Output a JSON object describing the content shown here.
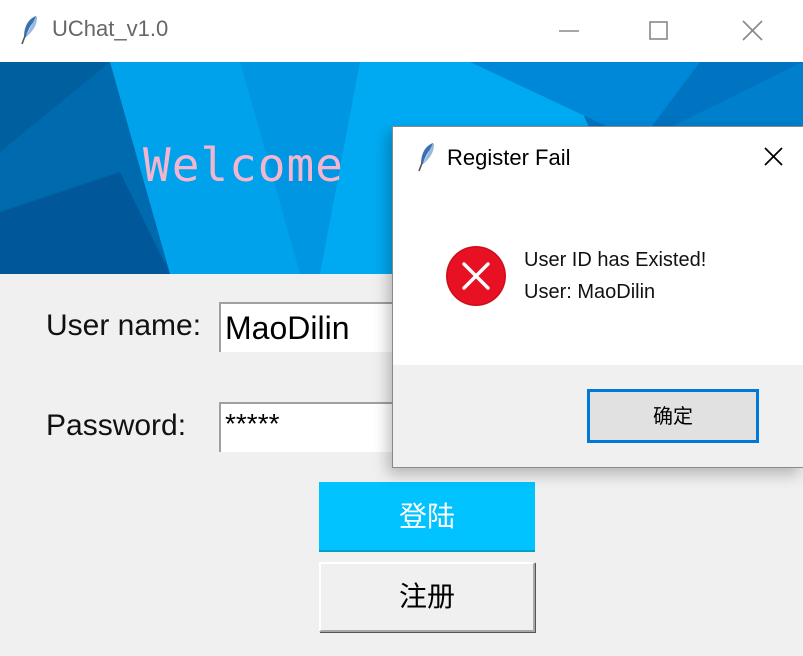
{
  "main_window": {
    "title": "UChat_v1.0",
    "icon": "feather-icon",
    "controls": [
      "minimize-icon",
      "maximize-icon",
      "close-icon"
    ]
  },
  "banner": {
    "text": "Welcome",
    "colors": [
      "#0060a0",
      "#0078c8",
      "#00a8f0",
      "#0090e0"
    ],
    "text_color": "#f4b6cf"
  },
  "form": {
    "username_label": "User name:",
    "username_value": "MaoDilin",
    "password_label": "Password:",
    "password_value": "*****",
    "login_button": "登陆",
    "register_button": "注册",
    "login_color": "#00c3ff"
  },
  "dialog": {
    "title": "Register Fail",
    "icon": "feather-icon",
    "status_icon": "error-icon",
    "message_line1": "User ID has Existed!",
    "message_line2": "User: MaoDilin",
    "ok_button": "确定",
    "accent_color": "#0078d7",
    "error_color": "#e81123"
  }
}
